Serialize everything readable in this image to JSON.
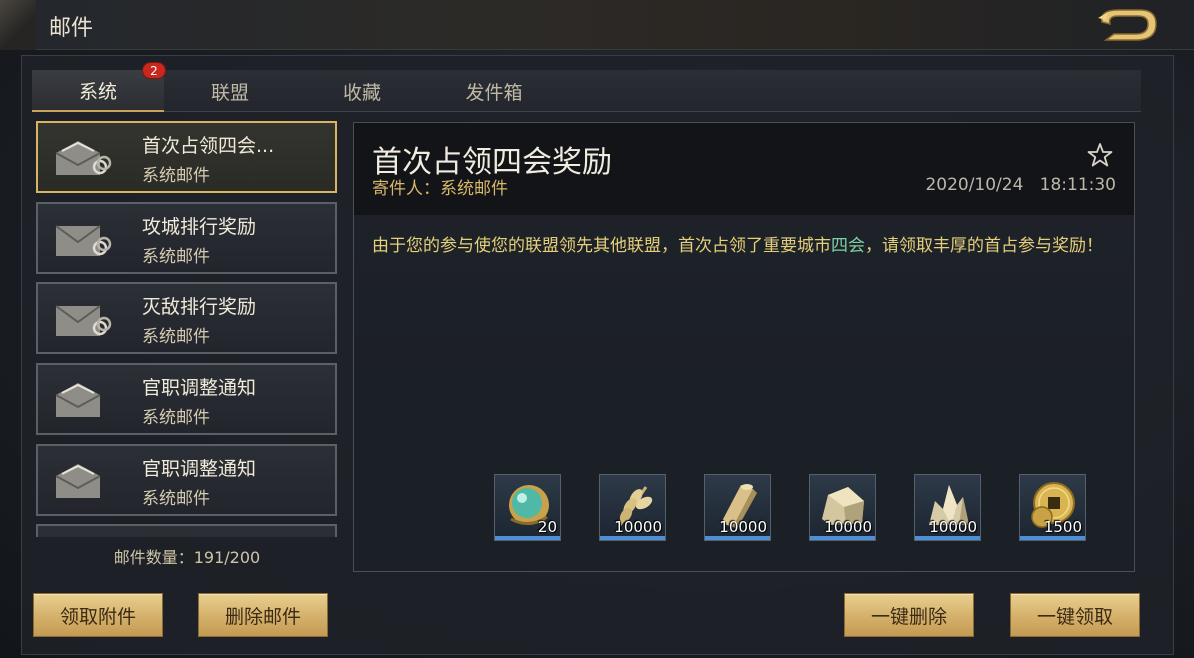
{
  "header": {
    "title": "邮件"
  },
  "tabs": [
    {
      "label": "系统",
      "badge": "2"
    },
    {
      "label": "联盟"
    },
    {
      "label": "收藏"
    },
    {
      "label": "发件箱"
    }
  ],
  "mail_list": [
    {
      "subject": "首次占领四会...",
      "sender": "系统邮件",
      "icon": "open-envelope-attachment-icon"
    },
    {
      "subject": "攻城排行奖励",
      "sender": "系统邮件",
      "icon": "envelope-attachment-icon"
    },
    {
      "subject": "灭敌排行奖励",
      "sender": "系统邮件",
      "icon": "envelope-attachment-icon"
    },
    {
      "subject": "官职调整通知",
      "sender": "系统邮件",
      "icon": "open-envelope-icon"
    },
    {
      "subject": "官职调整通知",
      "sender": "系统邮件",
      "icon": "open-envelope-icon"
    }
  ],
  "mail_count": "邮件数量：191/200",
  "detail": {
    "title": "首次占领四会奖励",
    "sender": "寄件人：系统邮件",
    "date": "2020/10/24",
    "time": "18:11:30",
    "body_before": "由于您的参与使您的联盟领先其他联盟，首次占领了重要城市",
    "body_highlight": "四会",
    "body_after": "，请领取丰厚的首占参与奖励！",
    "rewards": [
      {
        "icon": "jade-orb-icon",
        "qty": "20"
      },
      {
        "icon": "grain-icon",
        "qty": "10000"
      },
      {
        "icon": "wood-icon",
        "qty": "10000"
      },
      {
        "icon": "stone-icon",
        "qty": "10000"
      },
      {
        "icon": "iron-ore-icon",
        "qty": "10000"
      },
      {
        "icon": "copper-coin-icon",
        "qty": "1500"
      }
    ]
  },
  "buttons": {
    "claim_attachment": "领取附件",
    "delete_mail": "删除邮件",
    "delete_all": "一键删除",
    "claim_all": "一键领取"
  },
  "colors": {
    "gold": "#d9b65e",
    "highlight": "#7fd0a4",
    "badge": "#c8281e"
  }
}
